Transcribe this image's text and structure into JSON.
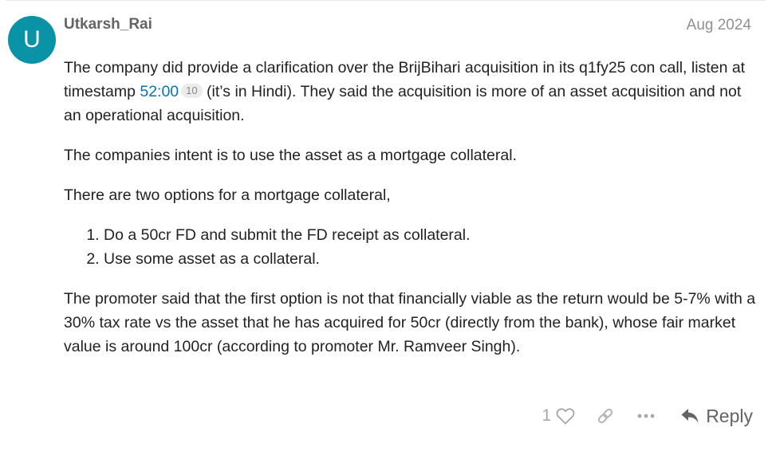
{
  "post": {
    "avatar_letter": "U",
    "username": "Utkarsh_Rai",
    "date": "Aug 2024",
    "para1_before": "The company did provide a clarification over the BrijBihari acquisition in its q1fy25 con call, listen at timestamp ",
    "timestamp_link": "52:00",
    "timestamp_clicks": "10",
    "para1_after": " (it’s in Hindi). They said the acquisition is more of an asset acquisition and not an operational acquisition.",
    "para2": "The companies intent is to use the asset as a mortgage collateral.",
    "para3": "There are two options for a mortgage collateral,",
    "options": [
      "Do a 50cr FD and submit the FD receipt as collateral.",
      "Use some asset as a collateral."
    ],
    "para4": "The promoter said that the first option is not that financially viable as the return would be 5-7% with a 30% tax rate vs the asset that he has acquired for 50cr (directly from the bank), whose fair market value is around 100cr (according to promoter Mr. Ramveer Singh)."
  },
  "actions": {
    "like_count": "1",
    "reply_label": "Reply"
  },
  "colors": {
    "avatar_bg": "#0a93a6",
    "link": "#0a73b3",
    "muted": "#919191"
  },
  "icons": [
    "heart-icon",
    "link-icon",
    "more-icon",
    "reply-icon"
  ]
}
